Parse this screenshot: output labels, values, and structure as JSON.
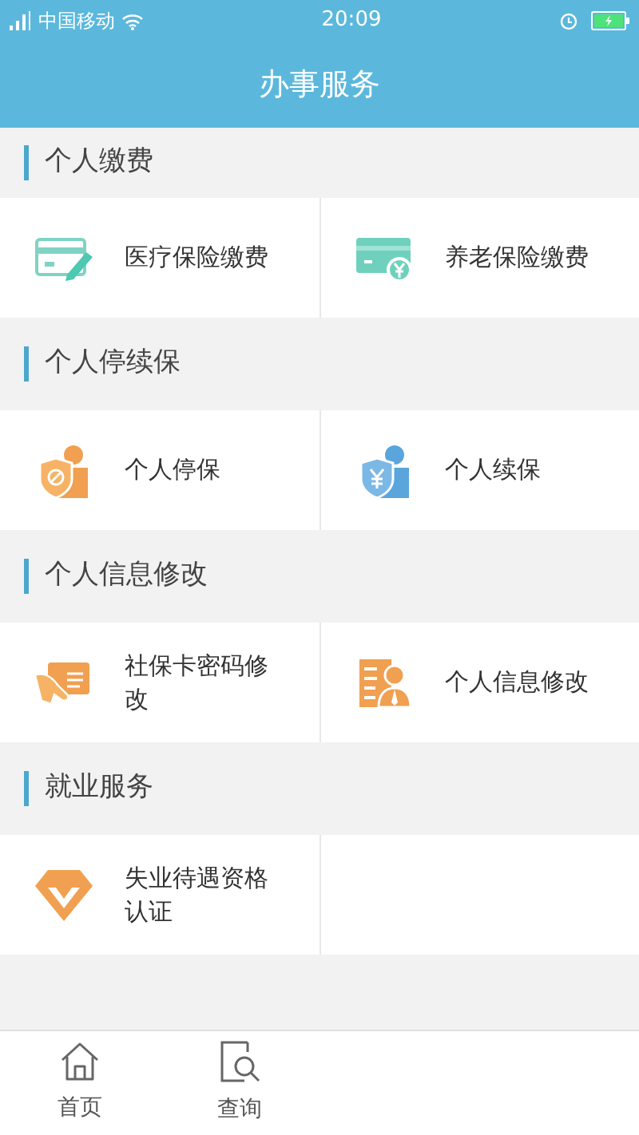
{
  "status_bar": {
    "carrier": "中国移动",
    "time": "20:09"
  },
  "header": {
    "title": "办事服务"
  },
  "sections": [
    {
      "title": "个人缴费",
      "items": [
        {
          "label": "医疗保险缴费"
        },
        {
          "label": "养老保险缴费"
        }
      ]
    },
    {
      "title": "个人停续保",
      "items": [
        {
          "label": "个人停保"
        },
        {
          "label": "个人续保"
        }
      ]
    },
    {
      "title": "个人信息修改",
      "items": [
        {
          "label": "社保卡密码修改"
        },
        {
          "label": "个人信息修改"
        }
      ]
    },
    {
      "title": "就业服务",
      "items": [
        {
          "label": "失业待遇资格认证"
        }
      ]
    }
  ],
  "tab_bar": [
    {
      "label": "首页"
    },
    {
      "label": "查询"
    }
  ]
}
